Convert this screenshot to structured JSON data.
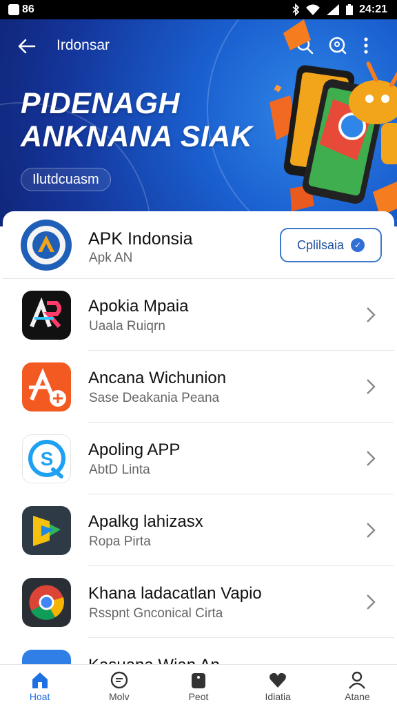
{
  "status_bar": {
    "time_left": "86",
    "time_right": "24:21"
  },
  "app_bar": {
    "title": "Irdonsar"
  },
  "hero": {
    "title_line1": "PIDENAGH",
    "title_line2": "ANKNANA SIAK",
    "chip": "Ilutdcuasm"
  },
  "featured": {
    "name": "APK Indonsia",
    "subtitle": "Apk AN",
    "button_label": "Cplilsaia",
    "button_badge_icon": "shield-check-icon"
  },
  "apps": [
    {
      "name": "Apokia Mpaia",
      "subtitle": "Uaala Ruiqrn",
      "icon": "ar-logo-icon"
    },
    {
      "name": "Ancana Wichunion",
      "subtitle": "Sase Deakania Peana",
      "icon": "a-plus-icon"
    },
    {
      "name": "Apoling APP",
      "subtitle": "AbtD Linta",
      "icon": "s-chat-icon"
    },
    {
      "name": "Apalkg lahizasx",
      "subtitle": "Ropa Pirta",
      "icon": "play-triangle-icon"
    },
    {
      "name": "Khana ladacatlan Vapio",
      "subtitle": "Rsspnt Gnconical Cirta",
      "icon": "chrome-icon"
    },
    {
      "name": "Kasuana Wian An",
      "subtitle": "",
      "icon": "blue-app-icon"
    }
  ],
  "bottom_nav": [
    {
      "label": "Hoat",
      "icon": "home-icon",
      "active": true
    },
    {
      "label": "Molv",
      "icon": "chat-icon",
      "active": false
    },
    {
      "label": "Peot",
      "icon": "bag-icon",
      "active": false
    },
    {
      "label": "Idiatia",
      "icon": "heart-icon",
      "active": false
    },
    {
      "label": "Atane",
      "icon": "person-icon",
      "active": false
    }
  ],
  "colors": {
    "accent": "#1e6fe0",
    "hero_dark": "#14359a",
    "hero_light": "#2f86e8"
  }
}
